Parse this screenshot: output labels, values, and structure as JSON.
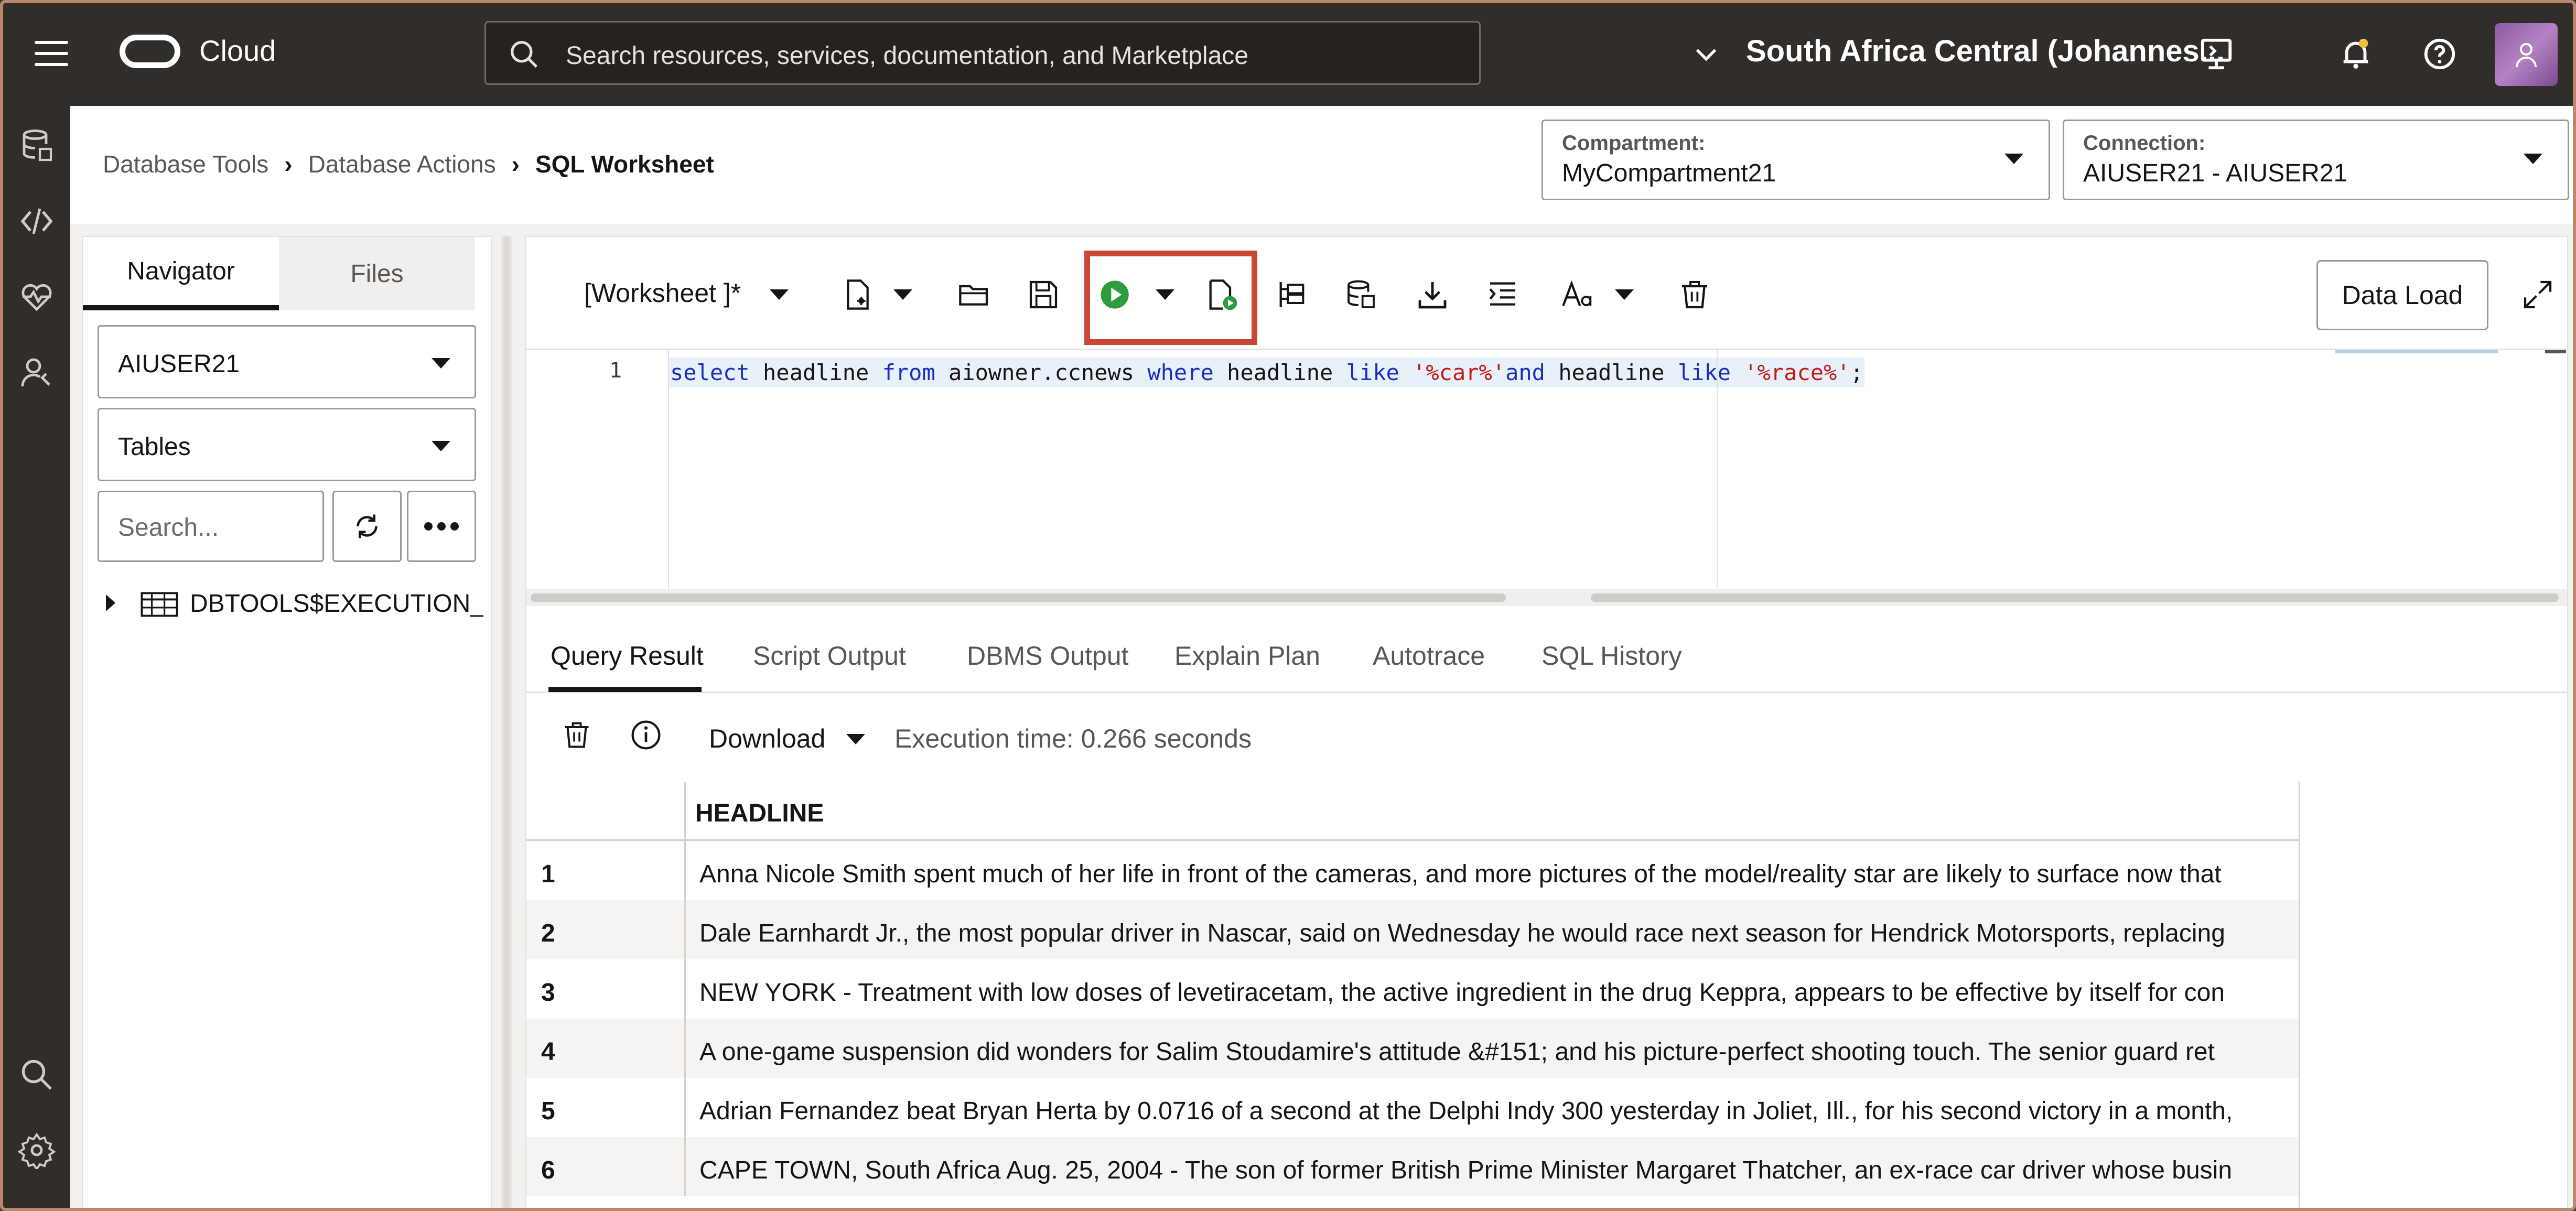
{
  "header": {
    "brand": "Cloud",
    "search_placeholder": "Search resources, services, documentation, and Marketplace",
    "region": "South Africa Central (Johannes..."
  },
  "breadcrumb": {
    "items": [
      "Database Tools",
      "Database Actions"
    ],
    "current": "SQL Worksheet"
  },
  "compartment": {
    "label": "Compartment:",
    "value": "MyCompartment21"
  },
  "connection": {
    "label": "Connection:",
    "value": "AIUSER21 - AIUSER21"
  },
  "navigator": {
    "tabs": [
      "Navigator",
      "Files"
    ],
    "schema": "AIUSER21",
    "object_type": "Tables",
    "search_placeholder": "Search...",
    "tree_items": [
      "DBTOOLS$EXECUTION_"
    ]
  },
  "toolbar": {
    "worksheet": "[Worksheet ]*",
    "data_load": "Data Load"
  },
  "editor": {
    "line_number": "1",
    "tokens": [
      {
        "t": "select",
        "c": "kw"
      },
      {
        "t": " headline ",
        "c": "plain"
      },
      {
        "t": "from",
        "c": "kw"
      },
      {
        "t": " aiowner.ccnews ",
        "c": "plain"
      },
      {
        "t": "where",
        "c": "kw"
      },
      {
        "t": " headline ",
        "c": "plain"
      },
      {
        "t": "like",
        "c": "kw"
      },
      {
        "t": " ",
        "c": "plain"
      },
      {
        "t": "'%car%'",
        "c": "str"
      },
      {
        "t": "and",
        "c": "kw"
      },
      {
        "t": " headline ",
        "c": "plain"
      },
      {
        "t": "like",
        "c": "kw"
      },
      {
        "t": " ",
        "c": "plain"
      },
      {
        "t": "'%race%'",
        "c": "str"
      },
      {
        "t": ";",
        "c": "plain"
      }
    ]
  },
  "results": {
    "tabs": [
      "Query Result",
      "Script Output",
      "DBMS Output",
      "Explain Plan",
      "Autotrace",
      "SQL History"
    ],
    "download_label": "Download",
    "execution_time": "Execution time: 0.266 seconds",
    "column": "HEADLINE",
    "rows": [
      {
        "n": "1",
        "headline": "Anna Nicole Smith spent much of her life in front of the cameras, and more pictures of the model/reality star are likely to surface now that"
      },
      {
        "n": "2",
        "headline": "Dale Earnhardt Jr., the most popular driver in Nascar, said on Wednesday he would race next season for Hendrick Motorsports, replacing"
      },
      {
        "n": "3",
        "headline": "NEW YORK - Treatment with low doses of levetiracetam, the active ingredient in the drug Keppra, appears to be effective by itself for con"
      },
      {
        "n": "4",
        "headline": "A one-game suspension did wonders for Salim Stoudamire's attitude &#151; and his picture-perfect shooting touch. The senior guard ret"
      },
      {
        "n": "5",
        "headline": "Adrian Fernandez beat Bryan Herta by 0.0716 of a second at the Delphi Indy 300 yesterday in Joliet, Ill., for his second victory in a month,"
      },
      {
        "n": "6",
        "headline": "CAPE TOWN, South Africa Aug. 25, 2004 - The son of former British Prime Minister Margaret Thatcher, an ex-race car driver whose busin"
      }
    ]
  },
  "colors": {
    "header_bg": "#312d2a",
    "run_green": "#2d9d3f",
    "highlight_red": "#c74634",
    "keyword_blue": "#1a2fbf",
    "string_red": "#c41a16"
  }
}
